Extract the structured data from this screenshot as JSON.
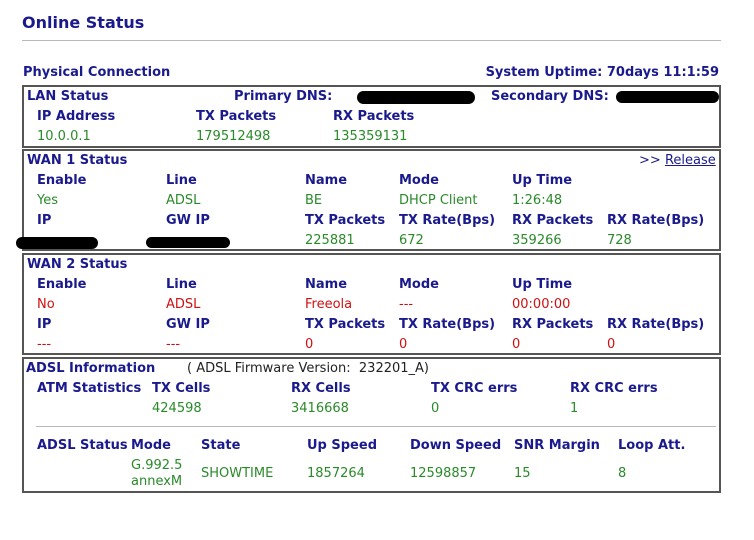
{
  "page_title": "Online Status",
  "physical_connection": "Physical Connection",
  "system_uptime": "System Uptime: 70days 11:1:59",
  "lan": {
    "title": "LAN Status",
    "primary_dns_label": "Primary DNS:",
    "secondary_dns_label": "Secondary DNS:",
    "headers": [
      "IP Address",
      "TX Packets",
      "RX Packets"
    ],
    "values": [
      "10.0.0.1",
      "179512498",
      "135359131"
    ]
  },
  "wan1": {
    "title": "WAN 1 Status",
    "release_prefix": ">>",
    "release_label": "Release",
    "headers1": [
      "Enable",
      "Line",
      "Name",
      "Mode",
      "Up Time"
    ],
    "values1": [
      "Yes",
      "ADSL",
      "BE",
      "DHCP Client",
      "1:26:48"
    ],
    "headers2": [
      "IP",
      "GW IP",
      "TX Packets",
      "TX Rate(Bps)",
      "RX Packets",
      "RX Rate(Bps)"
    ],
    "values2": [
      "225881",
      "672",
      "359266",
      "728"
    ]
  },
  "wan2": {
    "title": "WAN 2 Status",
    "headers1": [
      "Enable",
      "Line",
      "Name",
      "Mode",
      "Up Time"
    ],
    "values1": [
      "No",
      "ADSL",
      "Freeola",
      "---",
      "00:00:00"
    ],
    "headers2": [
      "IP",
      "GW IP",
      "TX Packets",
      "TX Rate(Bps)",
      "RX Packets",
      "RX Rate(Bps)"
    ],
    "values2": [
      "---",
      "---",
      "0",
      "0",
      "0",
      "0"
    ]
  },
  "adsl": {
    "title": "ADSL Information",
    "firmware_label": "( ADSL Firmware Version:",
    "firmware_value": "232201_A)",
    "atm_label": "ATM Statistics",
    "atm_headers": [
      "TX Cells",
      "RX Cells",
      "TX CRC errs",
      "RX CRC errs"
    ],
    "atm_values": [
      "424598",
      "3416668",
      "0",
      "1"
    ],
    "status_label": "ADSL Status",
    "status_headers": [
      "Mode",
      "State",
      "Up Speed",
      "Down Speed",
      "SNR Margin",
      "Loop Att."
    ],
    "mode_line1": "G.992.5",
    "mode_line2": "annexM",
    "status_values": [
      "SHOWTIME",
      "1857264",
      "12598857",
      "15",
      "8"
    ]
  }
}
